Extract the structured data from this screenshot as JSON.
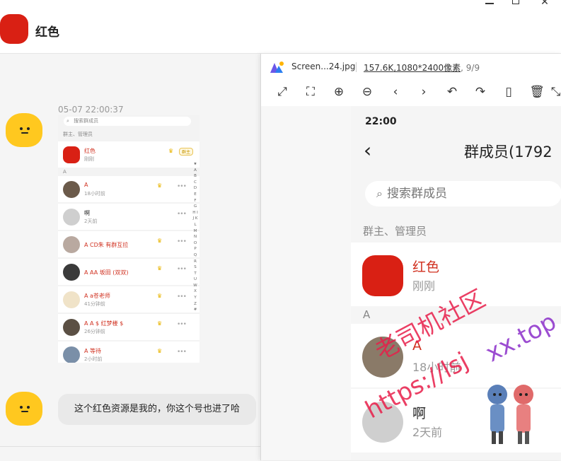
{
  "window": {
    "minimize": "—",
    "maximize": "□",
    "close": "✕"
  },
  "header": {
    "title": "红色"
  },
  "chat": {
    "timestamp": "05-07 22:00:37",
    "message": "这个红色资源是我的，你这个号也进了哈",
    "thumbnail": {
      "search": "搜索群成员",
      "section": "群主、管理员",
      "owner": {
        "name": "红色",
        "sub": "刚刚",
        "tag": "群主"
      },
      "letter": "A",
      "members": [
        {
          "name": "A",
          "sub": "18小时前",
          "crown": true
        },
        {
          "name": "啊",
          "sub": "2天前",
          "crown": false
        },
        {
          "name": "A  CD朱 有群互拉",
          "sub": "",
          "crown": true
        },
        {
          "name": "A AA 坂田 (双双)",
          "sub": "",
          "crown": true
        },
        {
          "name": "A a苍老师",
          "sub": "41分钟前",
          "crown": true
        },
        {
          "name": "A A $ 红梦楼 $",
          "sub": "26分钟前",
          "crown": true
        },
        {
          "name": "A 等待",
          "sub": "2小时前",
          "crown": true
        }
      ],
      "index": "★ A B C D E F G H I J K L M N O P Q R S T U W X Y Z #"
    }
  },
  "viewer": {
    "filename": "Screen...24.jpg",
    "size": "157.6K",
    "resolution": ",1080*2400像素",
    "page": ", 9/9",
    "tools": [
      "fit-screen-icon",
      "actual-size-icon",
      "zoom-in-icon",
      "zoom-out-icon",
      "previous-icon",
      "next-icon",
      "rotate-left-icon",
      "rotate-right-icon",
      "mouse-icon",
      "delete-icon",
      "more-icon"
    ],
    "phone": {
      "time": "22:00",
      "title": "群成员(1792",
      "search": "搜索群成员",
      "section": "群主、管理员",
      "owner": {
        "name": "红色",
        "sub": "刚刚"
      },
      "letter": "A",
      "members": [
        {
          "name": "A",
          "sub": "18小时前"
        },
        {
          "name": "啊",
          "sub": "2天前"
        }
      ]
    }
  },
  "watermark": {
    "cn": "老司机社区",
    "url_a": "https://lsj",
    "url_b": "xx.top"
  },
  "colors": {
    "brand_red": "#d92014",
    "bot_yellow": "#ffc81f",
    "accent_red_text": "#d0301f"
  }
}
